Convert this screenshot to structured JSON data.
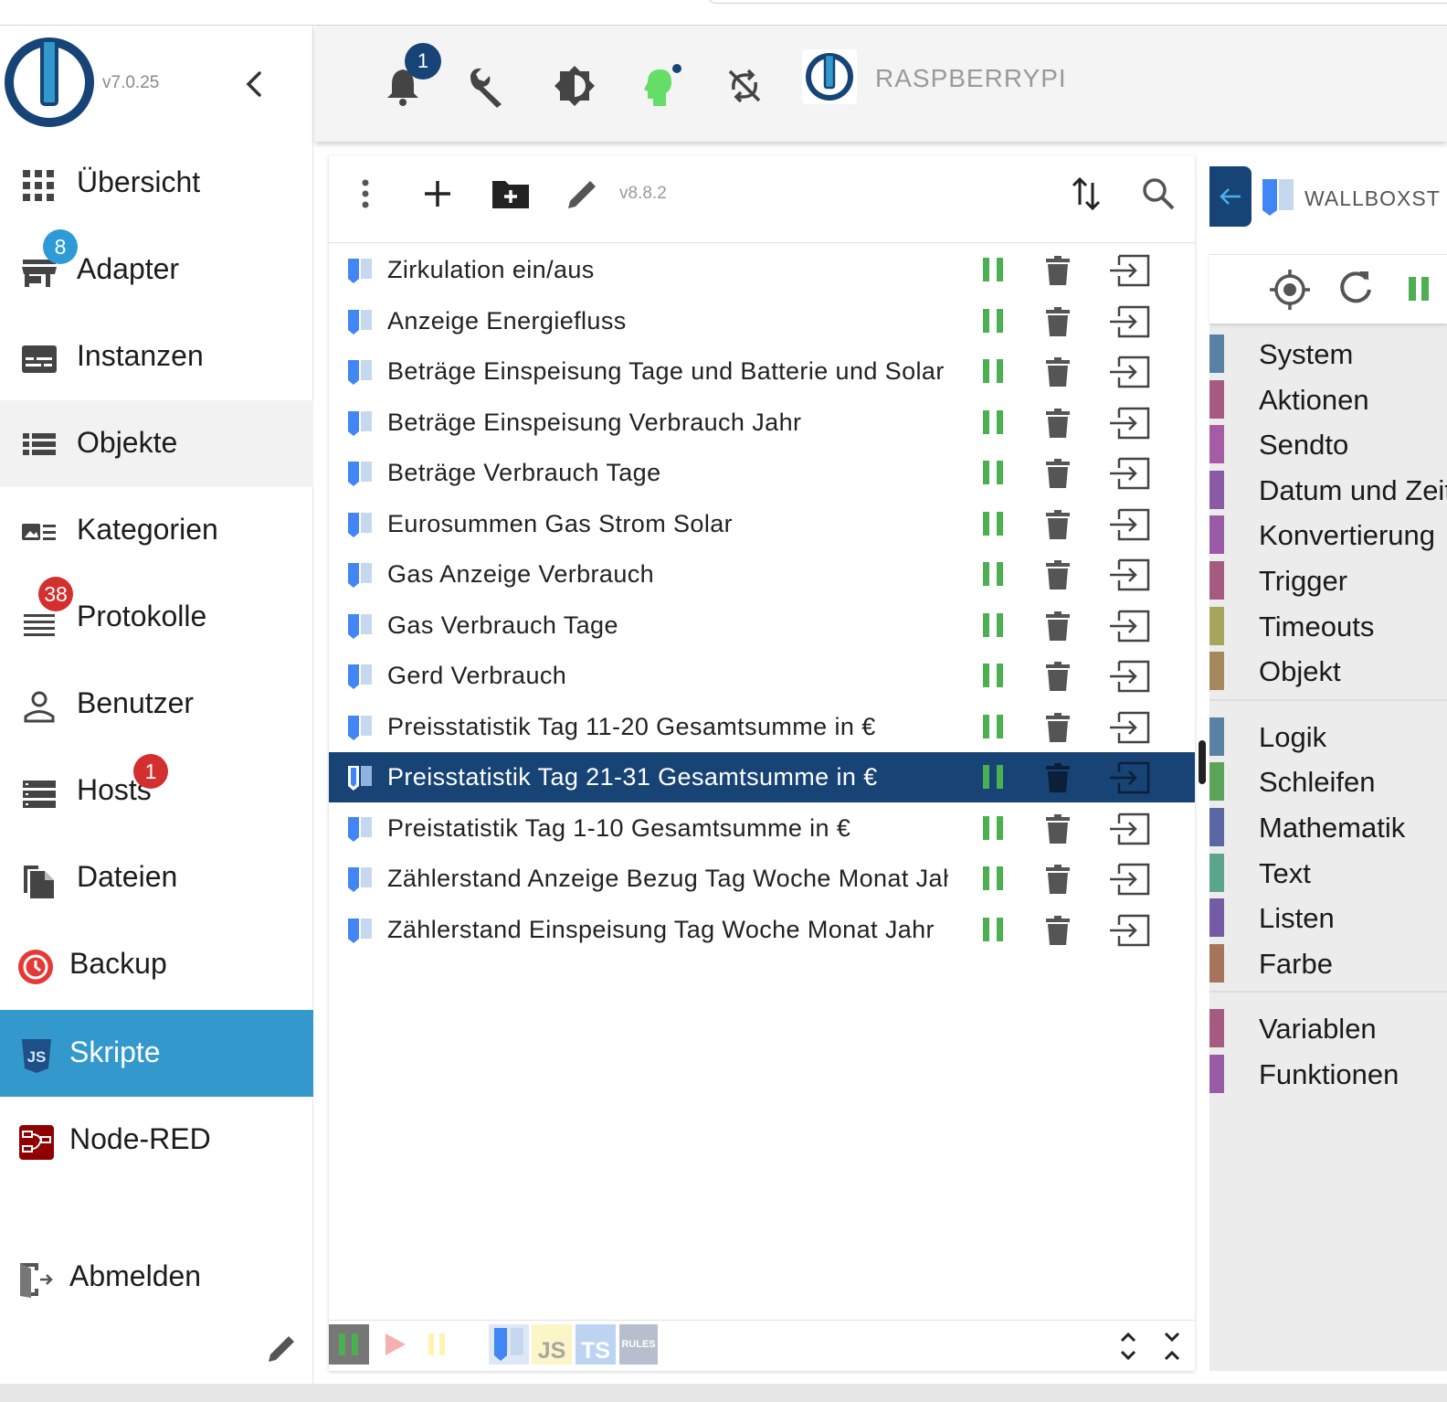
{
  "sidebar": {
    "version": "v7.0.25",
    "items": [
      {
        "label": "Übersicht",
        "icon": "grid-icon"
      },
      {
        "label": "Adapter",
        "icon": "store-icon",
        "badge": "8"
      },
      {
        "label": "Instanzen",
        "icon": "instances-icon"
      },
      {
        "label": "Objekte",
        "icon": "list-icon"
      },
      {
        "label": "Kategorien",
        "icon": "categories-icon"
      },
      {
        "label": "Protokolle",
        "icon": "log-icon",
        "badge": "38"
      },
      {
        "label": "Benutzer",
        "icon": "user-icon"
      },
      {
        "label": "Hosts",
        "icon": "hosts-icon",
        "badge": "1"
      },
      {
        "label": "Dateien",
        "icon": "files-icon"
      },
      {
        "label": "Backup",
        "icon": "backup-icon"
      },
      {
        "label": "Skripte",
        "icon": "js-icon"
      },
      {
        "label": "Node-RED",
        "icon": "node-red-icon"
      },
      {
        "label": "Abmelden",
        "icon": "logout-icon"
      }
    ],
    "active_item": "Skripte"
  },
  "toolbar": {
    "notification_count": "1",
    "host_name": "RASPBERRYPI"
  },
  "scripts_panel": {
    "adapter_version": "v8.8.2",
    "scripts": [
      {
        "name": "Zirkulation ein/aus"
      },
      {
        "name": "Anzeige Energiefluss"
      },
      {
        "name": "Beträge Einspeisung Tage und Batterie und Solar"
      },
      {
        "name": "Beträge Einspeisung Verbrauch Jahr"
      },
      {
        "name": "Beträge Verbrauch Tage"
      },
      {
        "name": "Eurosummen Gas Strom Solar"
      },
      {
        "name": "Gas Anzeige Verbrauch"
      },
      {
        "name": "Gas Verbrauch Tage"
      },
      {
        "name": "Gerd Verbrauch"
      },
      {
        "name": "Preisstatistik Tag 11-20 Gesamtsumme in €"
      },
      {
        "name": "Preisstatistik Tag 21-31 Gesamtsumme in €",
        "selected": true
      },
      {
        "name": "Preistatistik Tag 1-10 Gesamtsumme in €"
      },
      {
        "name": "Zählerstand Anzeige Bezug Tag Woche Monat Jahr"
      },
      {
        "name": "Zählerstand Einspeisung Tag Woche Monat Jahr"
      }
    ],
    "filter_labels": {
      "js": "JS",
      "ts": "TS",
      "rules": "RULES"
    }
  },
  "editor": {
    "tab_name": "WALLBOXST",
    "categories": [
      {
        "label": "System",
        "color": "#5b80a5"
      },
      {
        "label": "Aktionen",
        "color": "#a55b80"
      },
      {
        "label": "Sendto",
        "color": "#a55ba5"
      },
      {
        "label": "Datum und Zeit",
        "color": "#8a5ba5"
      },
      {
        "label": "Konvertierung",
        "color": "#995ba5"
      },
      {
        "label": "Trigger",
        "color": "#a55b80"
      },
      {
        "label": "Timeouts",
        "color": "#a5a55b"
      },
      {
        "label": "Objekt",
        "color": "#a5885b"
      },
      {
        "label": "Logik",
        "color": "#5b80a5"
      },
      {
        "label": "Schleifen",
        "color": "#5ba55b"
      },
      {
        "label": "Mathematik",
        "color": "#5b67a5"
      },
      {
        "label": "Text",
        "color": "#5ba58c"
      },
      {
        "label": "Listen",
        "color": "#745ba5"
      },
      {
        "label": "Farbe",
        "color": "#a5745b"
      },
      {
        "label": "Variablen",
        "color": "#a55b80"
      },
      {
        "label": "Funktionen",
        "color": "#995ba5"
      }
    ]
  },
  "colors": {
    "accent": "#3399cc",
    "selected_row": "#174375",
    "running_green": "#4caf50",
    "logo_blue": "#164477"
  }
}
